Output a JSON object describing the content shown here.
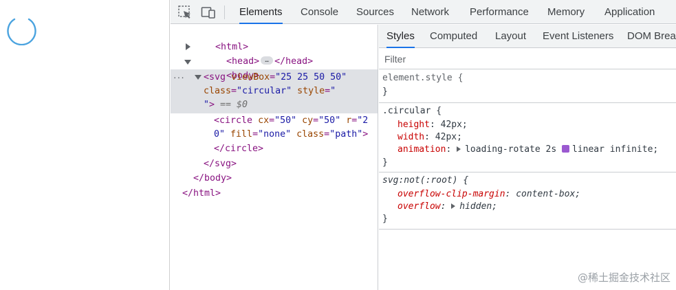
{
  "devtools": {
    "main_tabs": [
      "Elements",
      "Console",
      "Sources",
      "Network",
      "Performance",
      "Memory",
      "Application"
    ],
    "active_main_tab": "Elements",
    "sub_tabs": [
      "Styles",
      "Computed",
      "Layout",
      "Event Listeners",
      "DOM Breal"
    ],
    "active_sub_tab": "Styles",
    "filter_placeholder": "Filter",
    "toolbar_icons": [
      "inspect-element-icon",
      "device-toolbar-icon"
    ]
  },
  "dom_tree": {
    "html_open": "<html>",
    "head_open": "<head>",
    "head_ellipsis": "…",
    "head_close": "</head>",
    "body_open": "<body>",
    "gutter_dots": "...",
    "svg_line1_tag": "<svg",
    "svg_line1_attr": "viewBox",
    "svg_line1_eq": "=",
    "svg_line1_val": "\"25 25 50 50\"",
    "svg_line2_attr1": "class",
    "svg_line2_eq1": "=",
    "svg_line2_val1": "\"circular\"",
    "svg_line2_attr2": "style",
    "svg_line2_eq2": "=",
    "svg_line2_val2": "\"",
    "svg_line3_val": "\"",
    "svg_line3_close": ">",
    "svg_line3_marker": " == $0",
    "circle_line1_tag": "<circle",
    "circle_line1_a1": "cx",
    "circle_line1_v1": "\"50\"",
    "circle_line1_a2": "cy",
    "circle_line1_v2": "\"50\"",
    "circle_line1_a3": "r",
    "circle_line1_v3a": "\"2",
    "circle_line2_v3b": "0\"",
    "circle_line2_a4": "fill",
    "circle_line2_v4": "\"none\"",
    "circle_line2_a5": "class",
    "circle_line2_v5": "\"path\"",
    "circle_line2_close": ">",
    "circle_close": "</circle>",
    "svg_close": "</svg>",
    "body_close": "</body>",
    "html_close": "</html>"
  },
  "styles": {
    "element_style_selector": "element.style {",
    "element_style_close": "}",
    "circular_selector": ".circular {",
    "circular_props": [
      {
        "name": "height",
        "value": "42px;"
      },
      {
        "name": "width",
        "value": "42px;"
      },
      {
        "name": "animation",
        "value_pre": "loading-rotate 2s",
        "value_post": "linear infinite;"
      }
    ],
    "circular_close": "}",
    "svg_selector": "svg:not(:root) {",
    "svg_props": [
      {
        "name": "overflow-clip-margin",
        "value": "content-box;"
      },
      {
        "name": "overflow",
        "value": "hidden;"
      }
    ],
    "svg_close": "}"
  },
  "watermark": "@稀土掘金技术社区",
  "colors": {
    "accent": "#1a73e8",
    "spinner": "#4aa3df",
    "tag": "#881280",
    "attr": "#994500",
    "value": "#1a1aa6",
    "css_prop": "#c80000",
    "easing_swatch": "#9b59d0"
  }
}
